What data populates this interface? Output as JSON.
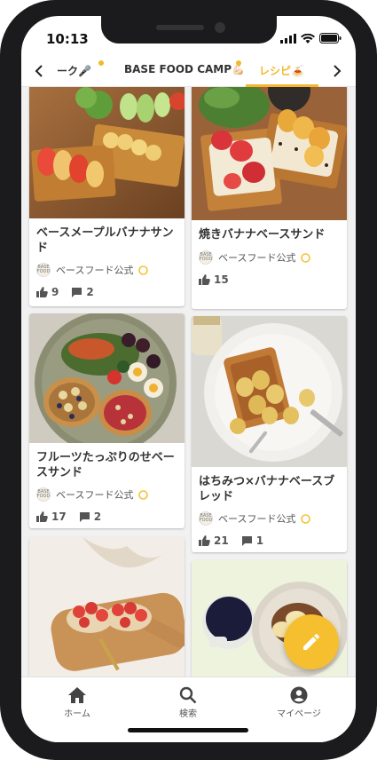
{
  "status": {
    "time": "10:13"
  },
  "tabs": {
    "partial_left": "ーク🎤",
    "middle": "BASE FOOD CAMP💪🏻",
    "active": "レシピ🍝"
  },
  "colors": {
    "accent": "#f3b82e",
    "fab": "#f6bf30"
  },
  "cards": [
    {
      "title": "ベースメープルバナナサンド",
      "author": "ベースフード公式",
      "likes": "9",
      "comments": "2"
    },
    {
      "title": "焼きバナナベースサンド",
      "author": "ベースフード公式",
      "likes": "15",
      "comments": ""
    },
    {
      "title": "フルーツたっぷりのせベースサンド",
      "author": "ベースフード公式",
      "likes": "17",
      "comments": "2"
    },
    {
      "title": "はちみつ×バナナベースブレッド",
      "author": "ベースフード公式",
      "likes": "21",
      "comments": "1"
    }
  ],
  "logo_text": "BASE FOOD",
  "nav": {
    "home": "ホーム",
    "search": "検索",
    "mypage": "マイページ"
  },
  "icons": [
    "chevron-left-icon",
    "chevron-right-icon",
    "thumbs-up-icon",
    "comment-icon",
    "verified-badge-icon",
    "pencil-icon",
    "home-icon",
    "search-icon",
    "account-icon",
    "signal-icon",
    "wifi-icon",
    "battery-icon"
  ]
}
